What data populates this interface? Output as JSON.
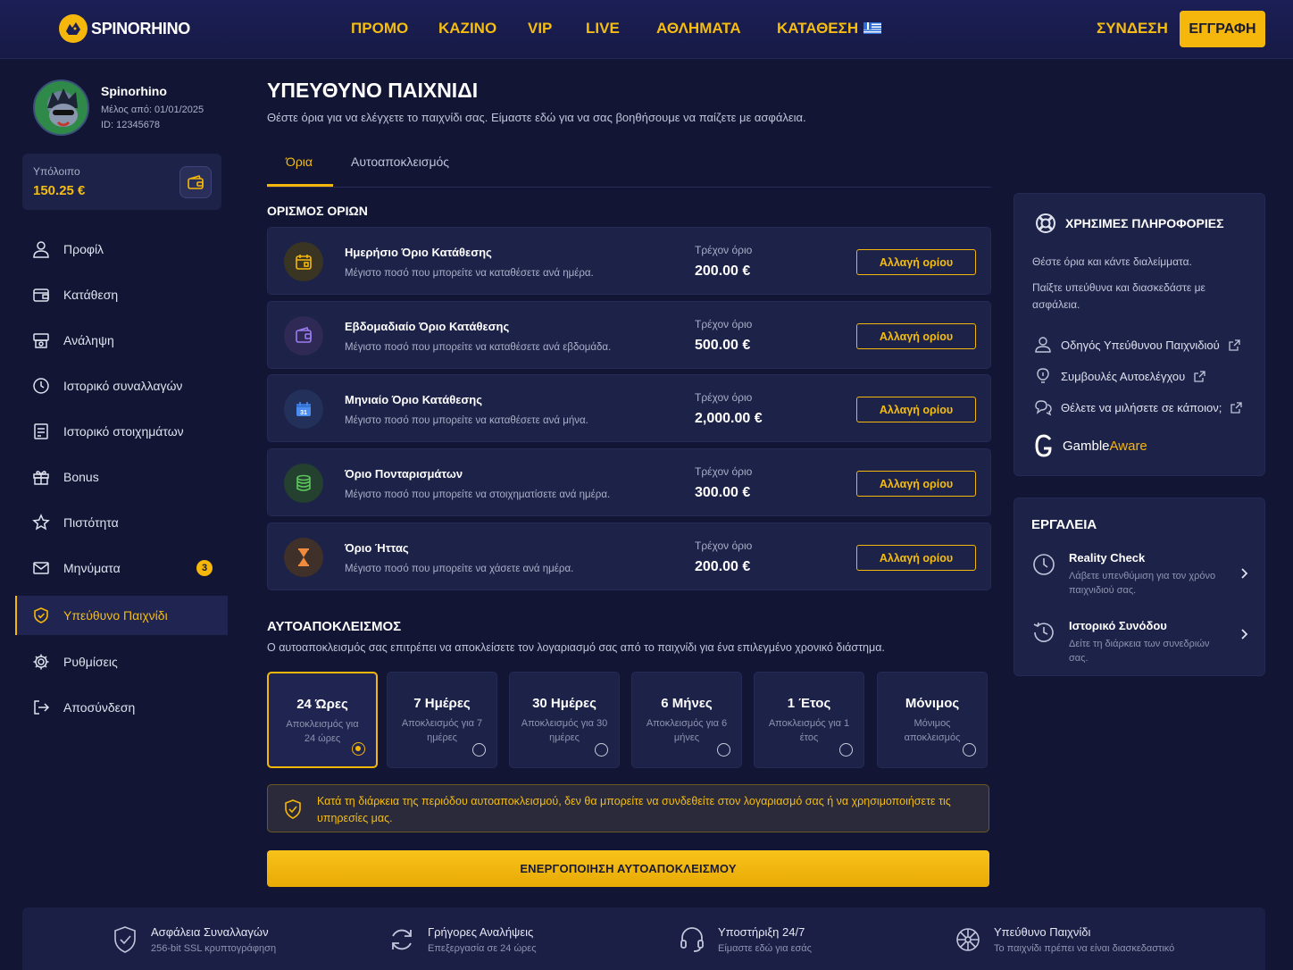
{
  "brand": {
    "name": "SPINORHINO"
  },
  "nav": {
    "items": [
      "ΠΡΟΜΟ",
      "ΚΑΖΙΝΟ",
      "VIP",
      "LIVE",
      "ΑΘΛΗΜΑΤΑ",
      "ΚΑΤΑΘΕΣΗ"
    ],
    "login": "ΣΥΝΔΕΣΗ",
    "register": "ΕΓΓΡΑΦΗ"
  },
  "user": {
    "name": "Spinorhino",
    "member_since": "Μέλος από: 01/01/2025",
    "id": "ID: 12345678"
  },
  "balance": {
    "label": "Υπόλοιπο",
    "value": "150.25 €"
  },
  "sidebar": {
    "items": [
      {
        "label": "Προφίλ",
        "icon": "user-icon"
      },
      {
        "label": "Κατάθεση",
        "icon": "wallet-icon"
      },
      {
        "label": "Ανάληψη",
        "icon": "withdraw-icon"
      },
      {
        "label": "Ιστορικό συναλλαγών",
        "icon": "clock-icon"
      },
      {
        "label": "Ιστορικό στοιχημάτων",
        "icon": "receipt-icon"
      },
      {
        "label": "Bonus",
        "icon": "gift-icon"
      },
      {
        "label": "Πιστότητα",
        "icon": "star-icon"
      },
      {
        "label": "Μηνύματα",
        "icon": "mail-icon",
        "badge": "3"
      },
      {
        "label": "Υπεύθυνο Παιχνίδι",
        "icon": "shield-icon",
        "active": true
      },
      {
        "label": "Ρυθμίσεις",
        "icon": "gear-icon"
      },
      {
        "label": "Αποσύνδεση",
        "icon": "logout-icon"
      }
    ]
  },
  "page": {
    "title": "ΥΠΕΥΘΥΝΟ ΠΑΙΧΝΙΔΙ",
    "subtitle": "Θέστε όρια για να ελέγχετε το παιχνίδι σας. Είμαστε εδώ για να σας βοηθήσουμε να παίζετε με ασφάλεια.",
    "tabs": [
      "Όρια",
      "Αυτοαποκλεισμός"
    ]
  },
  "limits": {
    "heading": "ΟΡΙΣΜΟΣ ΟΡΙΩΝ",
    "current_label": "Τρέχον όριο",
    "button": "Αλλαγή ορίου",
    "items": [
      {
        "title": "Ημερήσιο Όριο Κατάθεσης",
        "desc": "Μέγιστο ποσό που μπορείτε να καταθέσετε ανά ημέρα.",
        "value": "200.00 €",
        "icon": "calendar-icon",
        "color": "#f5b70b"
      },
      {
        "title": "Εβδομαδιαίο Όριο Κατάθεσης",
        "desc": "Μέγιστο ποσό που μπορείτε να καταθέσετε ανά εβδομάδα.",
        "value": "500.00 €",
        "icon": "wallet-icon",
        "color": "#9b7cf0"
      },
      {
        "title": "Μηνιαίο Όριο Κατάθεσης",
        "desc": "Μέγιστο ποσό που μπορείτε να καταθέσετε ανά μήνα.",
        "value": "2,000.00 €",
        "icon": "calendar-31-icon",
        "color": "#4a8cf0"
      },
      {
        "title": "Όριο Πονταρισμάτων",
        "desc": "Μέγιστο ποσό που μπορείτε να στοιχηματίσετε ανά ημέρα.",
        "value": "300.00 €",
        "icon": "coins-icon",
        "color": "#5cc85c"
      },
      {
        "title": "Όριο Ήττας",
        "desc": "Μέγιστο ποσό που μπορείτε να χάσετε ανά ημέρα.",
        "value": "200.00 €",
        "icon": "hourglass-icon",
        "color": "#f08a3c"
      }
    ]
  },
  "exclusion": {
    "heading": "ΑΥΤΟΑΠΟΚΛΕΙΣΜΟΣ",
    "desc": "Ο αυτοαποκλεισμός σας επιτρέπει να αποκλείσετε τον λογαριασμό σας από το παιχνίδι για ένα επιλεγμένο χρονικό διάστημα.",
    "options": [
      {
        "title": "24 Ώρες",
        "desc": "Αποκλεισμός για 24 ώρες",
        "selected": true
      },
      {
        "title": "7 Ημέρες",
        "desc": "Αποκλεισμός για 7 ημέρες"
      },
      {
        "title": "30 Ημέρες",
        "desc": "Αποκλεισμός για 30 ημέρες"
      },
      {
        "title": "6 Μήνες",
        "desc": "Αποκλεισμός για 6 μήνες"
      },
      {
        "title": "1 Έτος",
        "desc": "Αποκλεισμός για 1 έτος"
      },
      {
        "title": "Μόνιμος",
        "desc": "Μόνιμος αποκλεισμός"
      }
    ],
    "warning": "Κατά τη διάρκεια της περιόδου αυτοαποκλεισμού, δεν θα μπορείτε να συνδεθείτε στον λογαριασμό σας ή να χρησιμοποιήσετε τις υπηρεσίες μας.",
    "cta": "ΕΝΕΡΓΟΠΟΙΗΣΗ ΑΥΤΟΑΠΟΚΛΕΙΣΜΟΥ"
  },
  "info": {
    "title": "ΧΡΗΣΙΜΕΣ ΠΛΗΡΟΦΟΡΙΕΣ",
    "text1": "Θέστε όρια και κάντε διαλείμματα.",
    "text2": "Παίξτε υπεύθυνα και διασκεδάστε με ασφάλεια.",
    "links": [
      "Οδηγός Υπεύθυνου Παιχνιδιού",
      "Συμβουλές Αυτοελέγχου",
      "Θέλετε να μιλήσετε σε κάποιον;"
    ],
    "gamble": "Gamble",
    "aware": "Aware"
  },
  "tools": {
    "title": "ΕΡΓΑΛΕΙΑ",
    "items": [
      {
        "title": "Reality Check",
        "desc": "Λάβετε υπενθύμιση για τον χρόνο παιχνιδιού σας."
      },
      {
        "title": "Ιστορικό Συνόδου",
        "desc": "Δείτε τη διάρκεια των συνεδριών σας."
      }
    ]
  },
  "footer": {
    "items": [
      {
        "title": "Ασφάλεια Συναλλαγών",
        "desc": "256-bit SSL κρυπτογράφηση"
      },
      {
        "title": "Γρήγορες Αναλήψεις",
        "desc": "Επεξεργασία σε 24 ώρες"
      },
      {
        "title": "Υποστήριξη 24/7",
        "desc": "Είμαστε εδώ για εσάς"
      },
      {
        "title": "Υπεύθυνο Παιχνίδι",
        "desc": "Το παιχνίδι πρέπει να είναι διασκεδαστικό"
      }
    ]
  },
  "colors": {
    "accent": "#f5b70b",
    "bg": "#121634",
    "panel": "#1d2248"
  }
}
